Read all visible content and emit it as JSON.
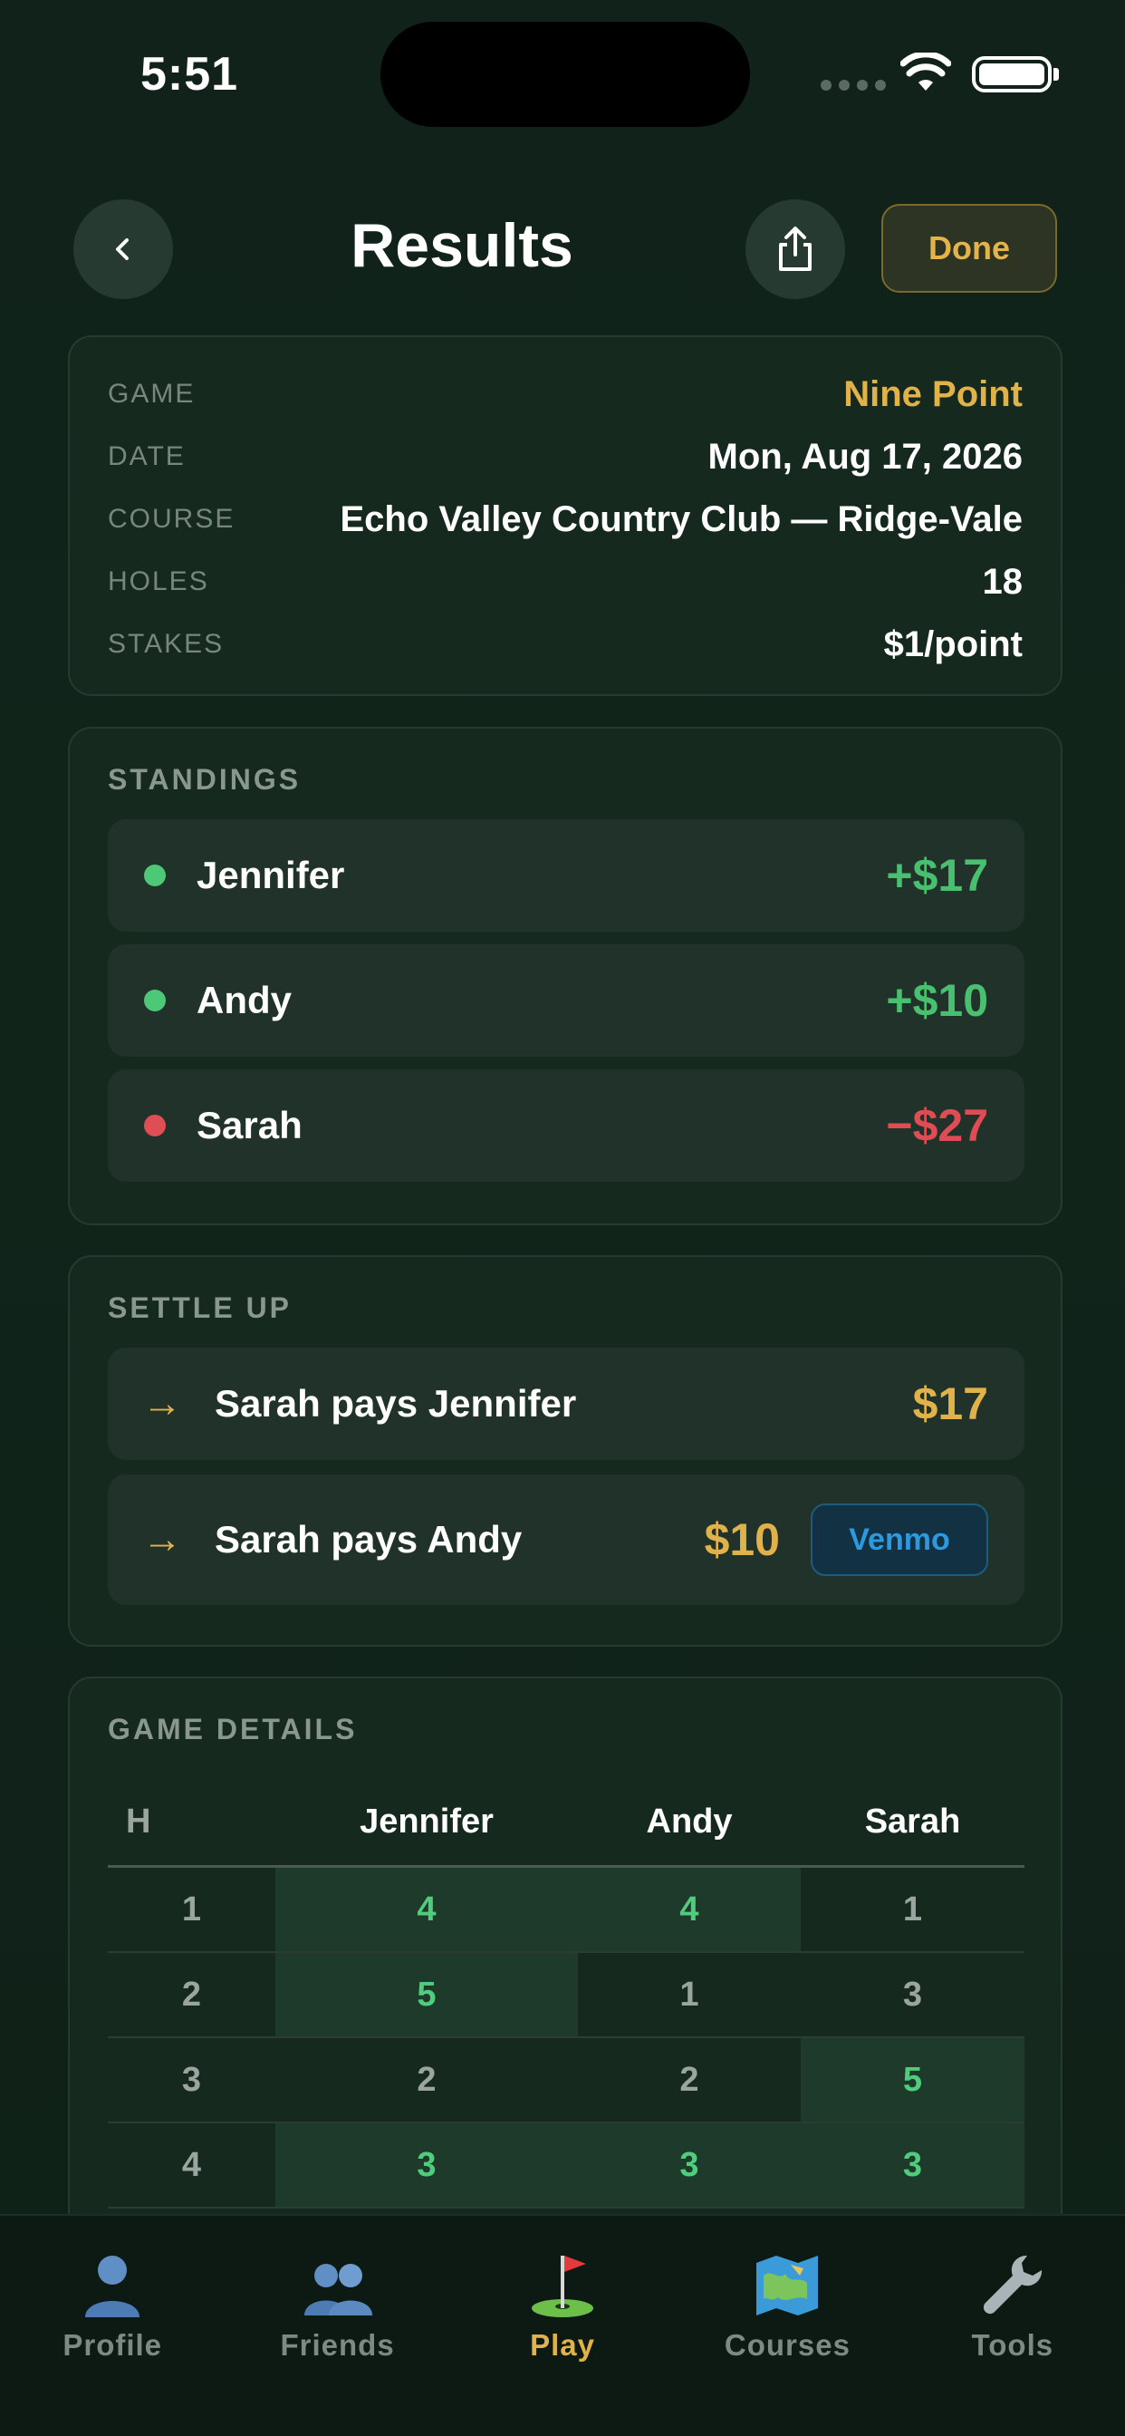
{
  "status_bar": {
    "time": "5:51"
  },
  "header": {
    "title": "Results",
    "done_label": "Done"
  },
  "game_info": {
    "rows": [
      {
        "label": "GAME",
        "value": "Nine Point"
      },
      {
        "label": "DATE",
        "value": "Mon, Aug 17, 2026"
      },
      {
        "label": "COURSE",
        "value": "Echo Valley Country Club — Ridge-Vale"
      },
      {
        "label": "HOLES",
        "value": "18"
      },
      {
        "label": "STAKES",
        "value": "$1/point"
      }
    ],
    "accent_color": "#e2b24a"
  },
  "standings": {
    "title": "STANDINGS",
    "players": [
      {
        "name": "Jennifer",
        "amount": "+$17",
        "status": "positive"
      },
      {
        "name": "Andy",
        "amount": "+$10",
        "status": "positive"
      },
      {
        "name": "Sarah",
        "amount": "−$27",
        "status": "negative"
      }
    ],
    "colors": {
      "positive": "#49c06f",
      "negative": "#e04c54"
    }
  },
  "settle_up": {
    "title": "SETTLE UP",
    "items": [
      {
        "text": "Sarah pays Jennifer",
        "amount": "$17"
      },
      {
        "text": "Sarah pays Andy",
        "amount": "$10",
        "action": "Venmo"
      }
    ]
  },
  "game_details": {
    "title": "GAME DETAILS",
    "columns": [
      "H",
      "Jennifer",
      "Andy",
      "Sarah"
    ],
    "rows": [
      {
        "hole": "1",
        "scores": [
          "4",
          "4",
          "1"
        ],
        "winners": [
          true,
          true,
          false
        ]
      },
      {
        "hole": "2",
        "scores": [
          "5",
          "1",
          "3"
        ],
        "winners": [
          true,
          false,
          false
        ]
      },
      {
        "hole": "3",
        "scores": [
          "2",
          "2",
          "5"
        ],
        "winners": [
          false,
          false,
          true
        ]
      },
      {
        "hole": "4",
        "scores": [
          "3",
          "3",
          "3"
        ],
        "winners": [
          true,
          true,
          true
        ]
      }
    ]
  },
  "tab_bar": {
    "tabs": [
      {
        "label": "Profile",
        "icon": "person-icon"
      },
      {
        "label": "Friends",
        "icon": "people-icon"
      },
      {
        "label": "Play",
        "icon": "golf-flag-icon",
        "active": true
      },
      {
        "label": "Courses",
        "icon": "map-icon"
      },
      {
        "label": "Tools",
        "icon": "wrench-icon"
      }
    ]
  }
}
